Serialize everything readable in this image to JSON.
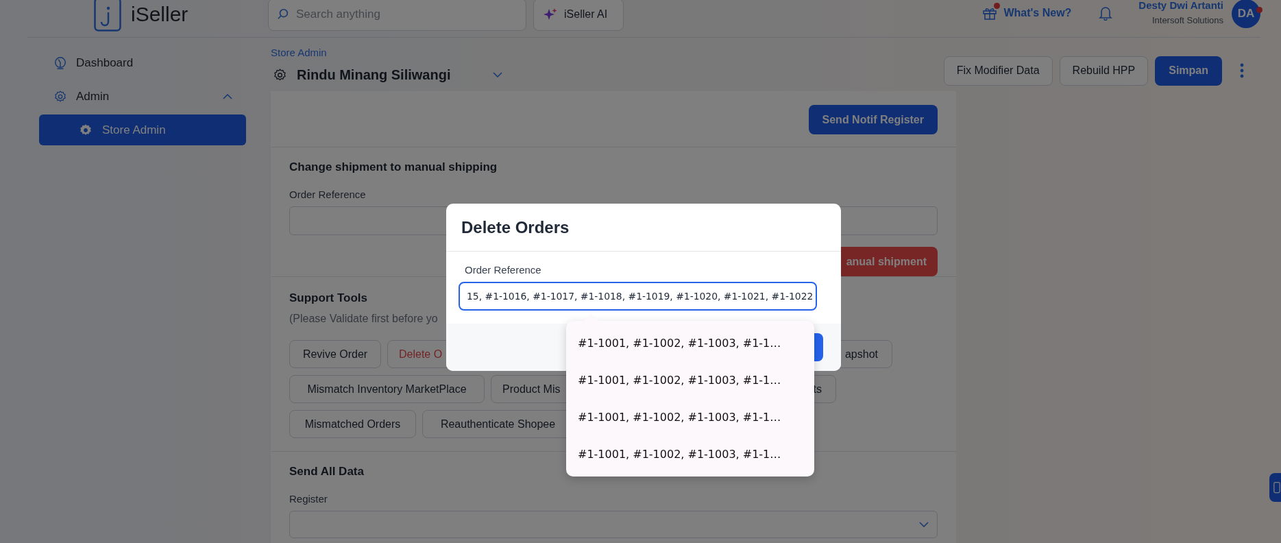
{
  "header": {
    "logo_text": "iSeller",
    "search": {
      "placeholder": "Search anything"
    },
    "ai_button": "iSeller AI",
    "whats_new": {
      "label": "What's New?",
      "has_dot": true
    },
    "user": {
      "name": "Desty Dwi Artanti",
      "org": "Intersoft Solutions",
      "initials": "DA",
      "has_dot": true
    }
  },
  "sidebar": {
    "items": [
      {
        "label": "Dashboard",
        "kind": "link",
        "selected": false
      },
      {
        "label": "Admin",
        "kind": "group",
        "expanded": true,
        "selected": false,
        "children": [
          {
            "label": "Store Admin",
            "selected": true
          }
        ]
      }
    ]
  },
  "page": {
    "breadcrumb": "Store Admin",
    "title": "Rindu Minang Siliwangi",
    "actions": [
      {
        "label": "Fix Modifier Data",
        "kind": "secondary"
      },
      {
        "label": "Rebuild HPP",
        "kind": "secondary"
      },
      {
        "label": "Simpan",
        "kind": "primary"
      }
    ]
  },
  "sections": [
    {
      "kind": "action",
      "button": "Send Notif Register"
    },
    {
      "kind": "form",
      "heading": "Change shipment to manual shipping",
      "label": "Order Reference",
      "button": "anual shipment"
    },
    {
      "kind": "tools",
      "heading": "Support Tools",
      "note": "(Please Validate first before yo",
      "tool_rows": [
        [
          {
            "label": "Revive Order",
            "kind": "normal"
          },
          {
            "label": "Delete O",
            "kind": "danger"
          },
          {
            "label": "apshot",
            "kind": "normal"
          }
        ],
        [
          {
            "label": "Mismatch Inventory MarketPlace",
            "kind": "normal"
          },
          {
            "label": "Product Mis",
            "kind": "normal"
          },
          {
            "label": "ts",
            "kind": "normal"
          }
        ],
        [
          {
            "label": "Mismatched Orders",
            "kind": "normal"
          },
          {
            "label": "Reauthenticate Shopee",
            "kind": "normal"
          }
        ]
      ]
    },
    {
      "kind": "select",
      "heading": "Send All Data",
      "label": "Register"
    }
  ],
  "modal": {
    "title": "Delete Orders",
    "label": "Order Reference",
    "value": "15, #1-1016, #1-1017, #1-1018, #1-1019, #1-1020, #1-1021, #1-1022",
    "suggestions": [
      "#1-1001, #1-1002, #1-1003, #1-1…",
      "#1-1001, #1-1002, #1-1003, #1-1…",
      "#1-1001, #1-1002, #1-1003, #1-1…",
      "#1-1001, #1-1002, #1-1003, #1-1…"
    ]
  }
}
